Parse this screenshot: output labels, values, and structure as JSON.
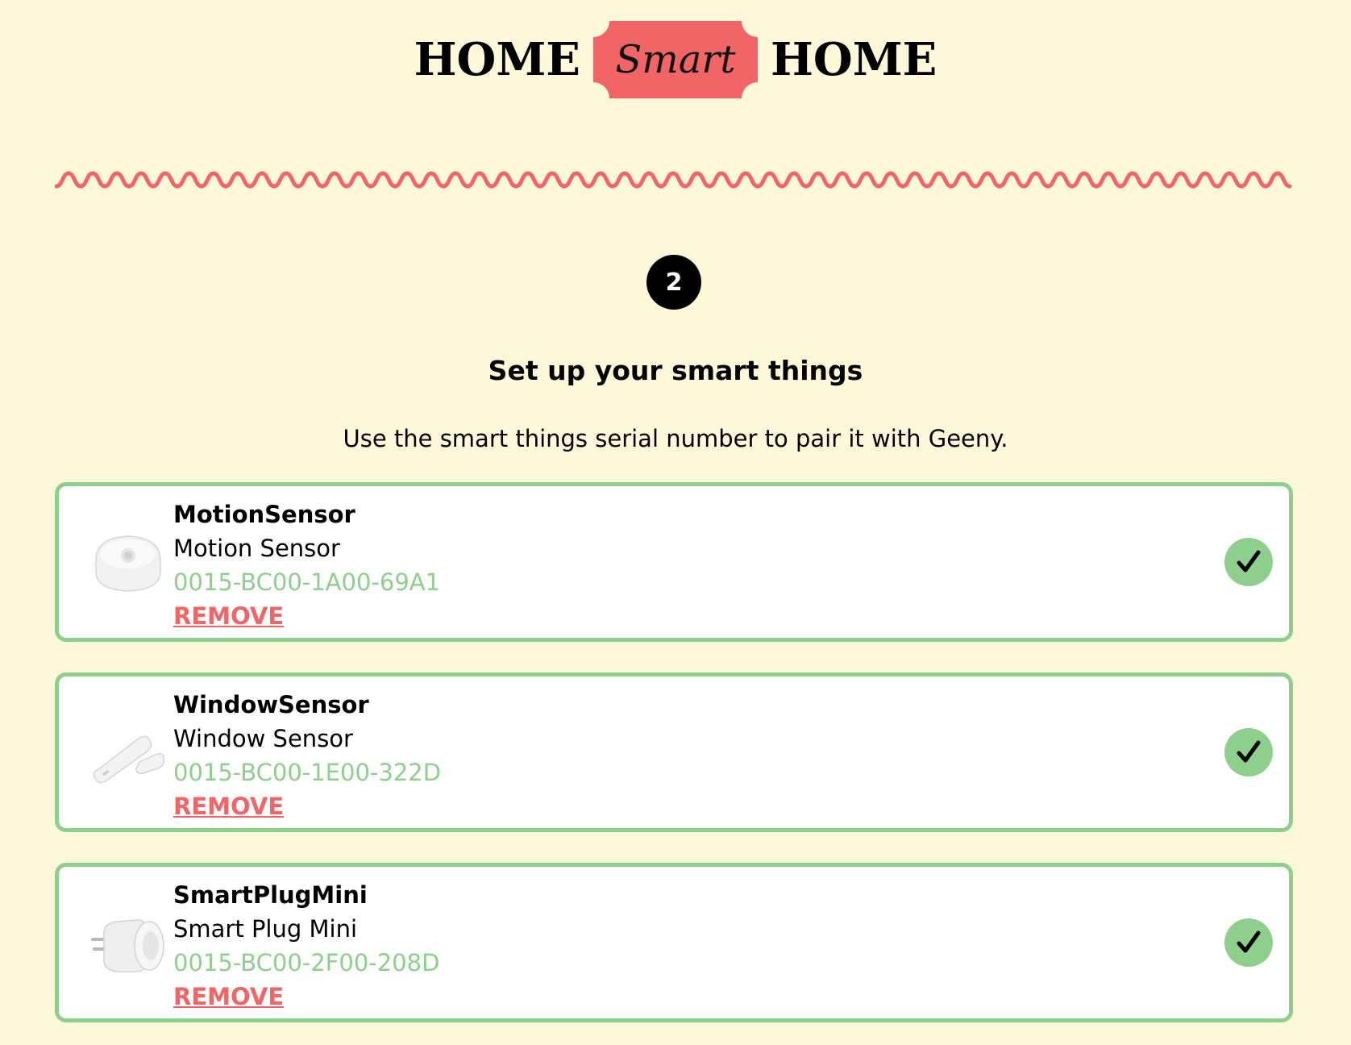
{
  "header": {
    "logo_left": "HOME",
    "logo_badge": "Smart",
    "logo_right": "HOME",
    "accent_color": "#f16567"
  },
  "step": {
    "number": "2",
    "title": "Set up your smart things",
    "subtitle": "Use the smart things serial number to pair it with Geeny."
  },
  "devices": [
    {
      "id": "MotionSensor",
      "name": "Motion Sensor",
      "serial": "0015-BC00-1A00-69A1",
      "remove_label": "REMOVE",
      "icon": "motion-sensor-image",
      "status_icon": "check-icon"
    },
    {
      "id": "WindowSensor",
      "name": "Window Sensor",
      "serial": "0015-BC00-1E00-322D",
      "remove_label": "REMOVE",
      "icon": "window-sensor-image",
      "status_icon": "check-icon"
    },
    {
      "id": "SmartPlugMini",
      "name": "Smart Plug Mini",
      "serial": "0015-BC00-2F00-208D",
      "remove_label": "REMOVE",
      "icon": "smart-plug-image",
      "status_icon": "check-icon"
    }
  ],
  "colors": {
    "background": "#fdf8da",
    "success": "#8ecf8d",
    "danger": "#f16567"
  }
}
